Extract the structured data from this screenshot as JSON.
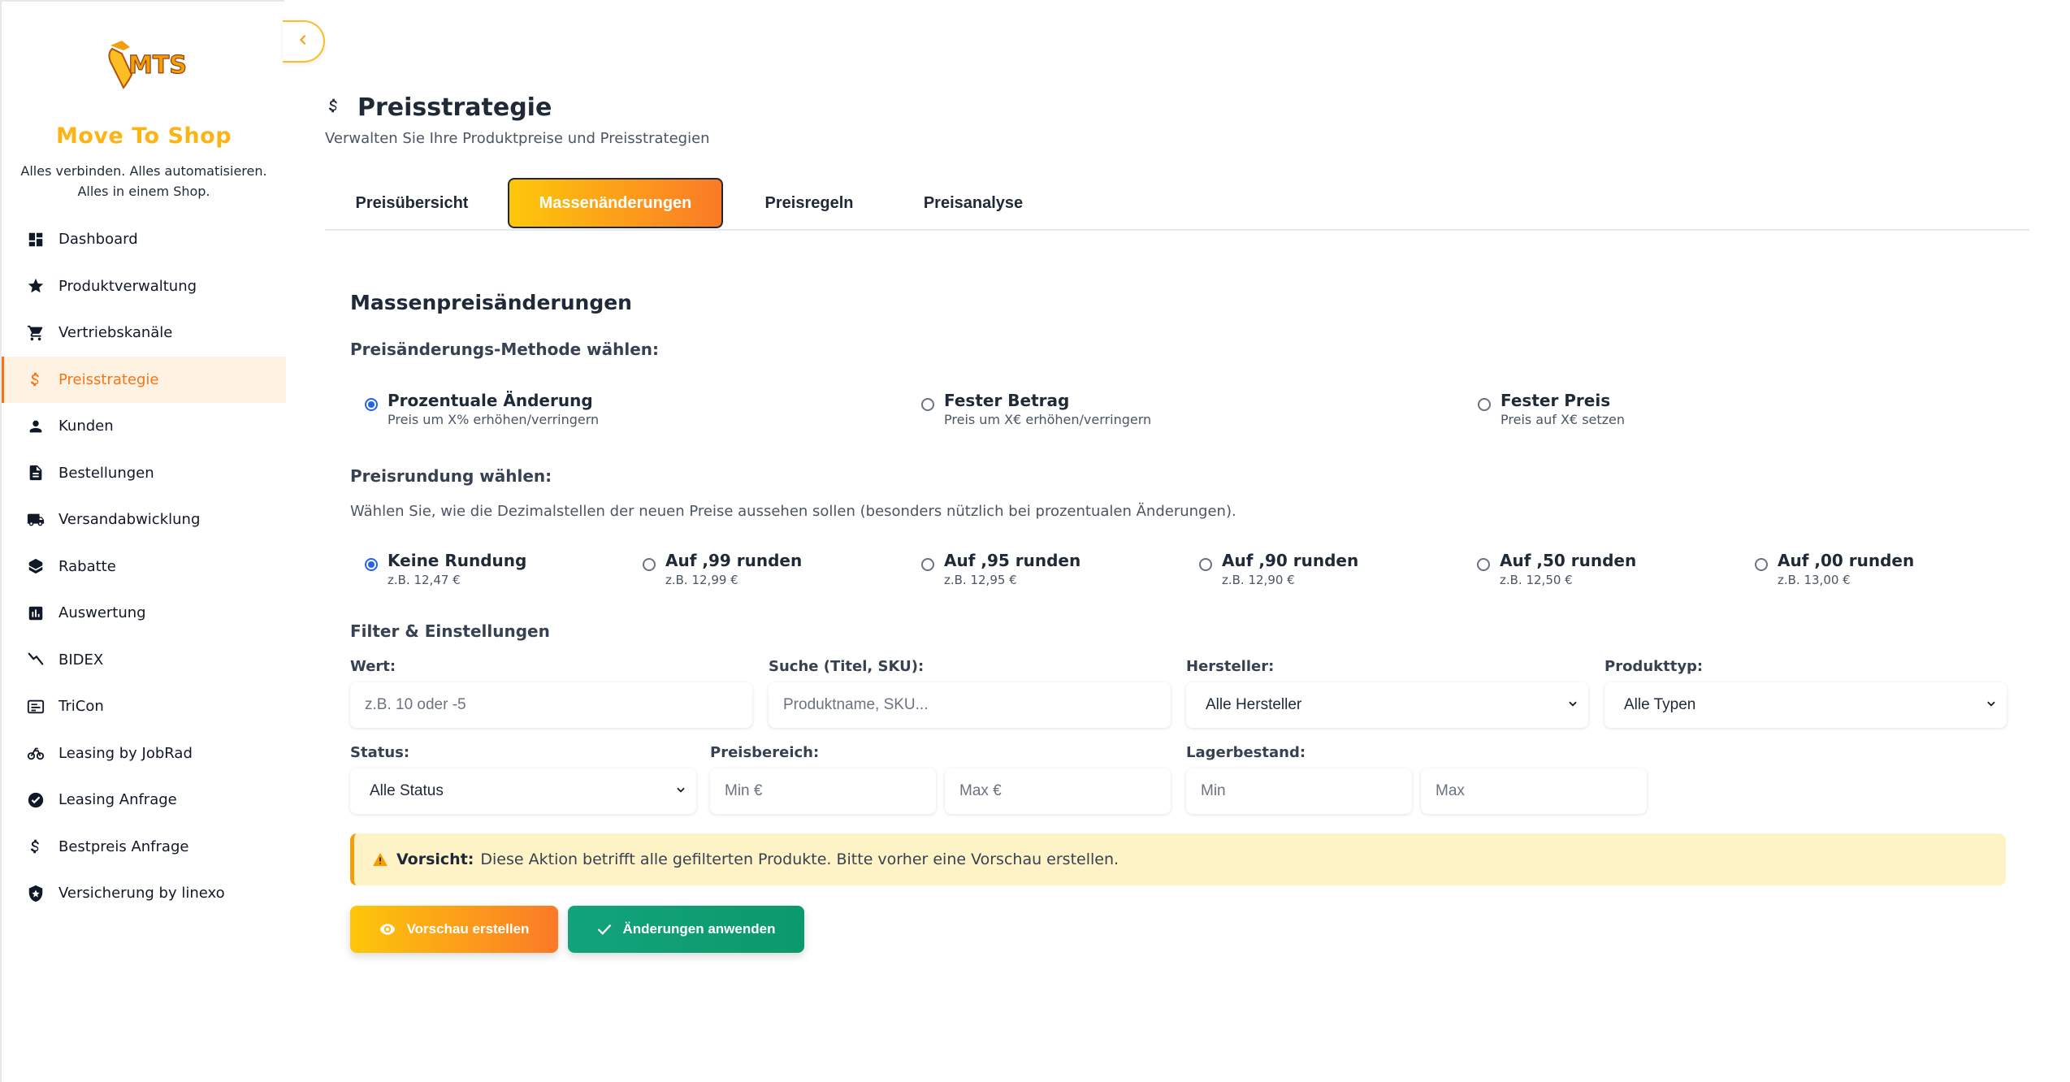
{
  "sidebar": {
    "brand": "Move To Shop",
    "logo_text": "MTS",
    "tagline_line1": "Alles verbinden. Alles automatisieren.",
    "tagline_line2": "Alles in einem Shop.",
    "items": [
      {
        "label": "Dashboard",
        "icon": "dashboard-icon"
      },
      {
        "label": "Produktverwaltung",
        "icon": "star-icon"
      },
      {
        "label": "Vertriebskanäle",
        "icon": "cart-icon"
      },
      {
        "label": "Preisstrategie",
        "icon": "dollar-icon",
        "active": true
      },
      {
        "label": "Kunden",
        "icon": "person-icon"
      },
      {
        "label": "Bestellungen",
        "icon": "document-icon"
      },
      {
        "label": "Versandabwicklung",
        "icon": "truck-icon"
      },
      {
        "label": "Rabatte",
        "icon": "tag-icon"
      },
      {
        "label": "Auswertung",
        "icon": "bar-chart-icon"
      },
      {
        "label": "BIDEX",
        "icon": "trend-icon"
      },
      {
        "label": "TriCon",
        "icon": "terminal-icon"
      },
      {
        "label": "Leasing by JobRad",
        "icon": "bike-icon"
      },
      {
        "label": "Leasing Anfrage",
        "icon": "check-circle-icon"
      },
      {
        "label": "Bestpreis Anfrage",
        "icon": "dollar-icon"
      },
      {
        "label": "Versicherung by linexo",
        "icon": "shield-icon"
      }
    ]
  },
  "header": {
    "title": "Preisstrategie",
    "subtitle": "Verwalten Sie Ihre Produktpreise und Preisstrategien"
  },
  "tabs": [
    {
      "label": "Preisübersicht"
    },
    {
      "label": "Massenänderungen",
      "active": true
    },
    {
      "label": "Preisregeln"
    },
    {
      "label": "Preisanalyse"
    }
  ],
  "content": {
    "section_title": "Massenpreisänderungen",
    "method_label": "Preisänderungs-Methode wählen:",
    "methods": [
      {
        "title": "Prozentuale Änderung",
        "sub": "Preis um X% erhöhen/verringern",
        "checked": true
      },
      {
        "title": "Fester Betrag",
        "sub": "Preis um X€ erhöhen/verringern",
        "checked": false
      },
      {
        "title": "Fester Preis",
        "sub": "Preis auf X€ setzen",
        "checked": false
      }
    ],
    "rounding_label": "Preisrundung wählen:",
    "rounding_hint": "Wählen Sie, wie die Dezimalstellen der neuen Preise aussehen sollen (besonders nützlich bei prozentualen Änderungen).",
    "roundings": [
      {
        "title": "Keine Rundung",
        "sub": "z.B. 12,47 €",
        "checked": true
      },
      {
        "title": "Auf ,99 runden",
        "sub": "z.B. 12,99 €",
        "checked": false
      },
      {
        "title": "Auf ,95 runden",
        "sub": "z.B. 12,95 €",
        "checked": false
      },
      {
        "title": "Auf ,90 runden",
        "sub": "z.B. 12,90 €",
        "checked": false
      },
      {
        "title": "Auf ,50 runden",
        "sub": "z.B. 12,50 €",
        "checked": false
      },
      {
        "title": "Auf ,00 runden",
        "sub": "z.B. 13,00 €",
        "checked": false
      }
    ],
    "filter_label": "Filter & Einstellungen",
    "fields": {
      "wert_label": "Wert:",
      "wert_placeholder": "z.B. 10 oder -5",
      "suche_label": "Suche (Titel, SKU):",
      "suche_placeholder": "Produktname, SKU...",
      "hersteller_label": "Hersteller:",
      "hersteller_value": "Alle Hersteller",
      "produkttyp_label": "Produkttyp:",
      "produkttyp_value": "Alle Typen",
      "status_label": "Status:",
      "status_value": "Alle Status",
      "preisbereich_label": "Preisbereich:",
      "preis_min_placeholder": "Min €",
      "preis_max_placeholder": "Max €",
      "lager_label": "Lagerbestand:",
      "lager_min_placeholder": "Min",
      "lager_max_placeholder": "Max"
    },
    "warning_bold": "Vorsicht:",
    "warning_text": "Diese Aktion betrifft alle gefilterten Produkte. Bitte vorher eine Vorschau erstellen.",
    "preview_button": "Vorschau erstellen",
    "apply_button": "Änderungen anwenden"
  },
  "colors": {
    "accent": "#f97316",
    "brand_yellow": "#fbb316",
    "apply_green": "#10a37f",
    "radio_checked": "#2563eb"
  }
}
